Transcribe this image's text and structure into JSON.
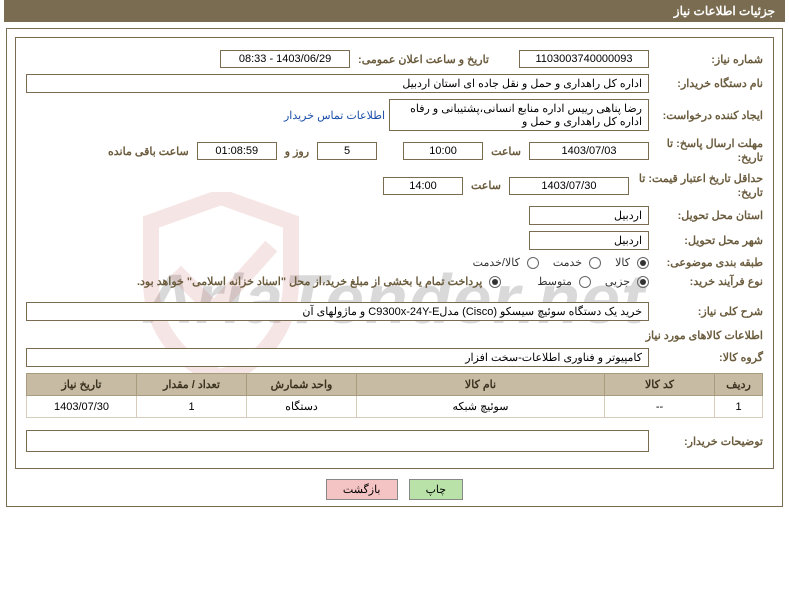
{
  "header": {
    "title": "جزئیات اطلاعات نیاز"
  },
  "labels": {
    "need_no": "شماره نیاز:",
    "announce_dt": "تاریخ و ساعت اعلان عمومی:",
    "buyer_name": "نام دستگاه خریدار:",
    "requester": "ایجاد کننده درخواست:",
    "buyer_contact": "اطلاعات تماس خریدار",
    "deadline": "مهلت ارسال پاسخ: تا تاریخ:",
    "deadline_l1": "مهلت ارسال پاسخ: تا",
    "deadline_l2": "تاریخ:",
    "time": "ساعت",
    "days_and": "روز و",
    "remain": "ساعت باقی مانده",
    "validity": "حداقل تاریخ اعتبار قیمت: تا تاریخ:",
    "validity_l1": "حداقل تاریخ اعتبار قیمت: تا",
    "validity_l2": "تاریخ:",
    "deliver_prov": "استان محل تحویل:",
    "deliver_city": "شهر محل تحویل:",
    "category": "طبقه بندی موضوعی:",
    "cat_goods": "کالا",
    "cat_service": "خدمت",
    "cat_both": "کالا/خدمت",
    "buy_type": "نوع فرآیند خرید:",
    "bt_partial": "جزیی",
    "bt_medium": "متوسط",
    "payment_note": "پرداخت تمام یا بخشی از مبلغ خرید،از محل \"اسناد خزانه اسلامی\" خواهد بود.",
    "desc": "شرح کلی نیاز:",
    "items_info": "اطلاعات کالاهای مورد نیاز",
    "group": "گروه کالا:",
    "buyer_notes": "توضیحات خریدار:"
  },
  "values": {
    "need_no": "1103003740000093",
    "announce_dt": "1403/06/29 - 08:33",
    "buyer_name": "اداره کل راهداری و حمل و نقل جاده ای استان اردبیل",
    "requester": "رضا پناهی رییس اداره منابع انسانی،پشتیبانی و رفاه اداره کل راهداری و حمل و",
    "deadline_date": "1403/07/03",
    "deadline_time": "10:00",
    "remain_days": "5",
    "remain_time": "01:08:59",
    "validity_date": "1403/07/30",
    "validity_time": "14:00",
    "province": "اردبیل",
    "city": "اردبیل",
    "desc": "خرید یک دستگاه سوئیچ سیسکو (Cisco) مدلC9300x-24Y-E و ماژولهای آن",
    "group": "کامپیوتر و فناوری اطلاعات-سخت افزار",
    "buyer_notes": ""
  },
  "table": {
    "headers": {
      "row": "ردیف",
      "code": "کد کالا",
      "name": "نام کالا",
      "unit": "واحد شمارش",
      "qty": "تعداد / مقدار",
      "need_date": "تاریخ نیاز"
    },
    "rows": [
      {
        "row": "1",
        "code": "--",
        "name": "سوئیچ شبکه",
        "unit": "دستگاه",
        "qty": "1",
        "need_date": "1403/07/30"
      }
    ]
  },
  "buttons": {
    "print": "چاپ",
    "back": "بازگشت"
  },
  "watermark": "AriaTender.net"
}
